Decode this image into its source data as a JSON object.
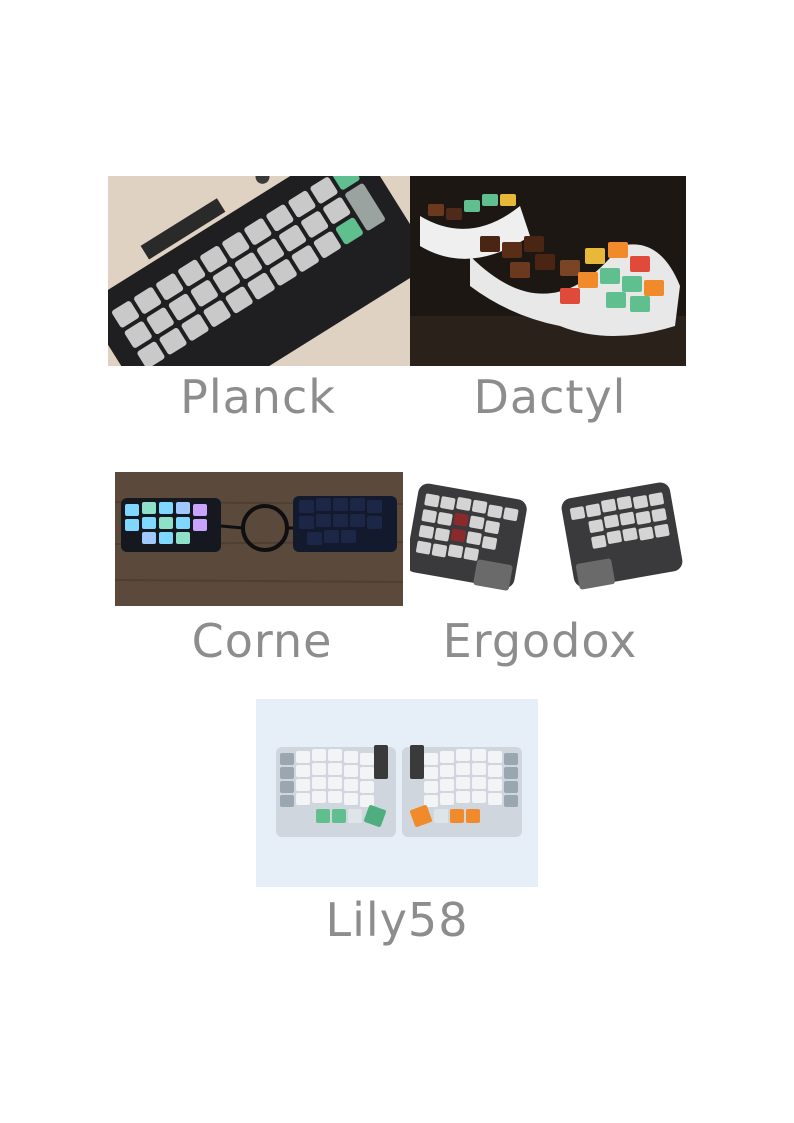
{
  "keyboards": [
    {
      "name": "Planck",
      "image": "planck-keyboard-photo"
    },
    {
      "name": "Dactyl",
      "image": "dactyl-keyboard-photo"
    },
    {
      "name": "Corne",
      "image": "corne-keyboard-photo"
    },
    {
      "name": "Ergodox",
      "image": "ergodox-keyboard-photo"
    },
    {
      "name": "Lily58",
      "image": "lily58-keyboard-photo"
    }
  ],
  "colors": {
    "caption": "#8d8d8d",
    "key_green": "#5fbf8f",
    "key_orange": "#f08a2a",
    "rgb_glow": "#7fd8ff"
  }
}
